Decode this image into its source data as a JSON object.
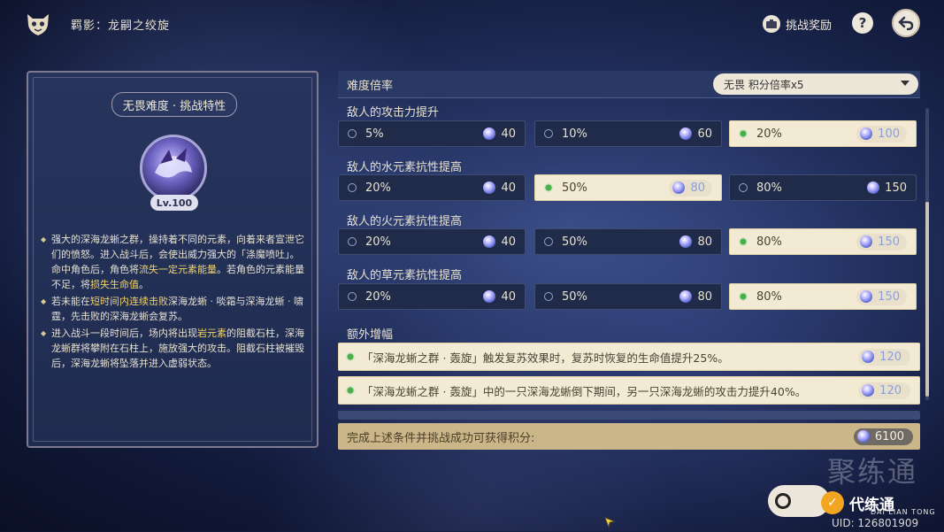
{
  "header": {
    "breadcrumb": "羁影：龙嗣之绞旋",
    "reward_label": "挑战奖励",
    "help_label": "?"
  },
  "left_panel": {
    "title": "无畏难度 · 挑战特性",
    "level": "Lv.100",
    "p1_a": "强大的深海龙蜥之群，操持着不同的元素，向着来者宣泄它们的愤怒。进入战斗后，会使出威力强大的「涤魔喷吐」。命中角色后，角色将",
    "p1_hl1": "流失一定元素能量",
    "p1_b": "。若角色的元素能量不足，将",
    "p1_hl2": "损失生命值",
    "p1_c": "。",
    "p2_a": "若未能在",
    "p2_hl": "短时间内连续击败",
    "p2_b": "深海龙蜥 · 啖霜与深海龙蜥 · 啸霆，先击败的深海龙蜥会复苏。",
    "p3_a": "进入战斗一段时间后，场内将出现",
    "p3_hl": "岩元素",
    "p3_b": "的阻截石柱，深海龙蜥群将攀附在石柱上，施放强大的攻击。阻截石柱被摧毁后，深海龙蜥将坠落并进入虚弱状态。"
  },
  "difficulty": {
    "label": "难度倍率",
    "selected": "无畏  积分倍率x5"
  },
  "sections": [
    {
      "title": "敌人的攻击力提升",
      "options": [
        {
          "pct": "5%",
          "pts": "40",
          "selected": false
        },
        {
          "pct": "10%",
          "pts": "60",
          "selected": false
        },
        {
          "pct": "20%",
          "pts": "100",
          "selected": true
        }
      ]
    },
    {
      "title": "敌人的水元素抗性提高",
      "options": [
        {
          "pct": "20%",
          "pts": "40",
          "selected": false
        },
        {
          "pct": "50%",
          "pts": "80",
          "selected": true
        },
        {
          "pct": "80%",
          "pts": "150",
          "selected": false
        }
      ]
    },
    {
      "title": "敌人的火元素抗性提高",
      "options": [
        {
          "pct": "20%",
          "pts": "40",
          "selected": false
        },
        {
          "pct": "50%",
          "pts": "80",
          "selected": false
        },
        {
          "pct": "80%",
          "pts": "150",
          "selected": true
        }
      ]
    },
    {
      "title": "敌人的草元素抗性提高",
      "options": [
        {
          "pct": "20%",
          "pts": "40",
          "selected": false
        },
        {
          "pct": "50%",
          "pts": "80",
          "selected": false
        },
        {
          "pct": "80%",
          "pts": "150",
          "selected": true
        }
      ]
    }
  ],
  "extra": {
    "title": "额外增幅",
    "items": [
      {
        "text": "「深海龙蜥之群 · 轰旋」触发复苏效果时，复苏时恢复的生命值提升25%。",
        "pts": "120"
      },
      {
        "text": "「深海龙蜥之群 · 轰旋」中的一只深海龙蜥倒下期间，另一只深海龙蜥的攻击力提升40%。",
        "pts": "120"
      }
    ]
  },
  "total": {
    "label": "完成上述条件并挑战成功可获得积分:",
    "pts": "6100"
  },
  "overlay": {
    "brand_name": "代练通",
    "brand_sub": "DAI LIAN TONG",
    "watermark_text": "聚练通",
    "uid": "UID: 126801909"
  },
  "colors": {
    "selected_bg": "#f3ead4",
    "unselected_bg": "#202b4a",
    "highlight": "#f3d36b",
    "radio_on": "#4bb04a"
  }
}
